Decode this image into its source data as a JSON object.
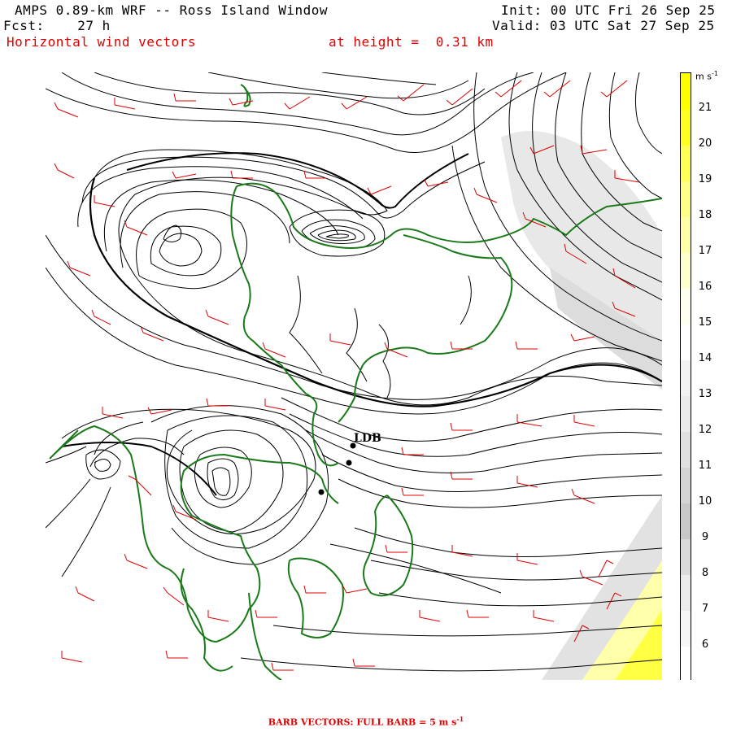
{
  "header": {
    "title": "AMPS 0.89-km WRF -- Ross Island Window",
    "init": "Init: 00 UTC Fri 26 Sep 25",
    "fcst_label": "Fcst:",
    "fcst_value": "27 h",
    "valid": "Valid: 03 UTC Sat 27 Sep 25",
    "field": "Horizontal wind vectors",
    "height_label": "at height =",
    "height_value": "0.31 km"
  },
  "colorbar": {
    "unit": "m s",
    "unit_exp": "-1",
    "ticks": [
      "21",
      "20",
      "19",
      "18",
      "17",
      "16",
      "15",
      "14",
      "13",
      "12",
      "11",
      "10",
      "9",
      "8",
      "7",
      "6"
    ],
    "colors": [
      "#ffff00",
      "#ffff22",
      "#ffff55",
      "#ffff88",
      "#ffffaa",
      "#ffffcc",
      "#fffff0",
      "#ffffff",
      "#f2f2f2",
      "#eaeaea",
      "#e0e0e0",
      "#d4d4d4",
      "#c8c8c8",
      "#dadada",
      "#ebebeb",
      "#f6f6f6",
      "#ffffff"
    ]
  },
  "map": {
    "station_label": "LDB",
    "coastline_color": "#1a7a1a",
    "barb_color": "#e00000",
    "contour_color": "#000000"
  },
  "footer": {
    "text_prefix": "BARB VECTORS:  FULL BARB = 5 m s",
    "text_exp": "-1"
  }
}
